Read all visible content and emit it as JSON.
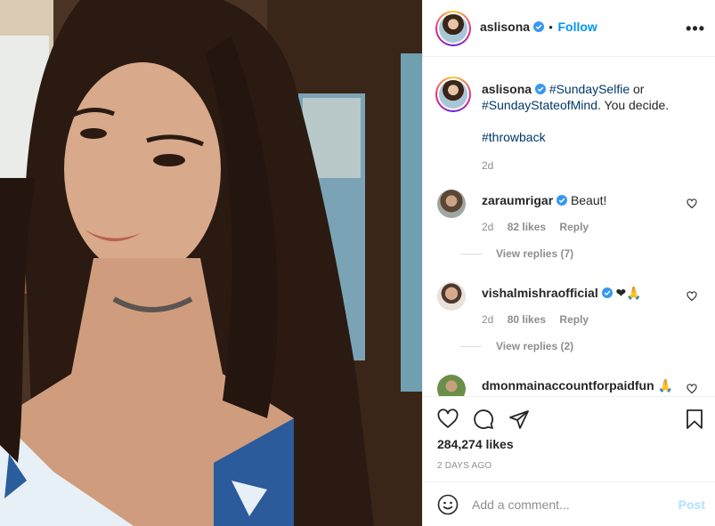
{
  "post": {
    "username": "aslisona",
    "follow_label": "Follow",
    "bullet": "•",
    "more_label": "•••"
  },
  "caption": {
    "username": "aslisona",
    "tag1": "#SundaySelfie",
    "text1": " or",
    "tag2": "#SundayStateofMind",
    "text2": ". You decide.",
    "tag3": "#throwback",
    "age": "2d"
  },
  "comments": [
    {
      "username": "zaraumrigar",
      "text": "Beaut!",
      "age": "2d",
      "likes": "82 likes",
      "reply": "Reply",
      "view_replies": "View replies (7)"
    },
    {
      "username": "vishalmishraofficial",
      "text": "❤🙏",
      "age": "2d",
      "likes": "80 likes",
      "reply": "Reply",
      "view_replies": "View replies (2)"
    },
    {
      "username": "dmonmainaccountforpaidfun",
      "text": "🙏"
    }
  ],
  "footer": {
    "likes": "284,274 likes",
    "posted": "2 DAYS AGO",
    "comment_placeholder": "Add a comment...",
    "post_label": "Post"
  },
  "colors": {
    "link": "#0095f6",
    "hashtag": "#00376b",
    "muted": "#8e8e8e",
    "post_disabled": "#b2dffc"
  }
}
